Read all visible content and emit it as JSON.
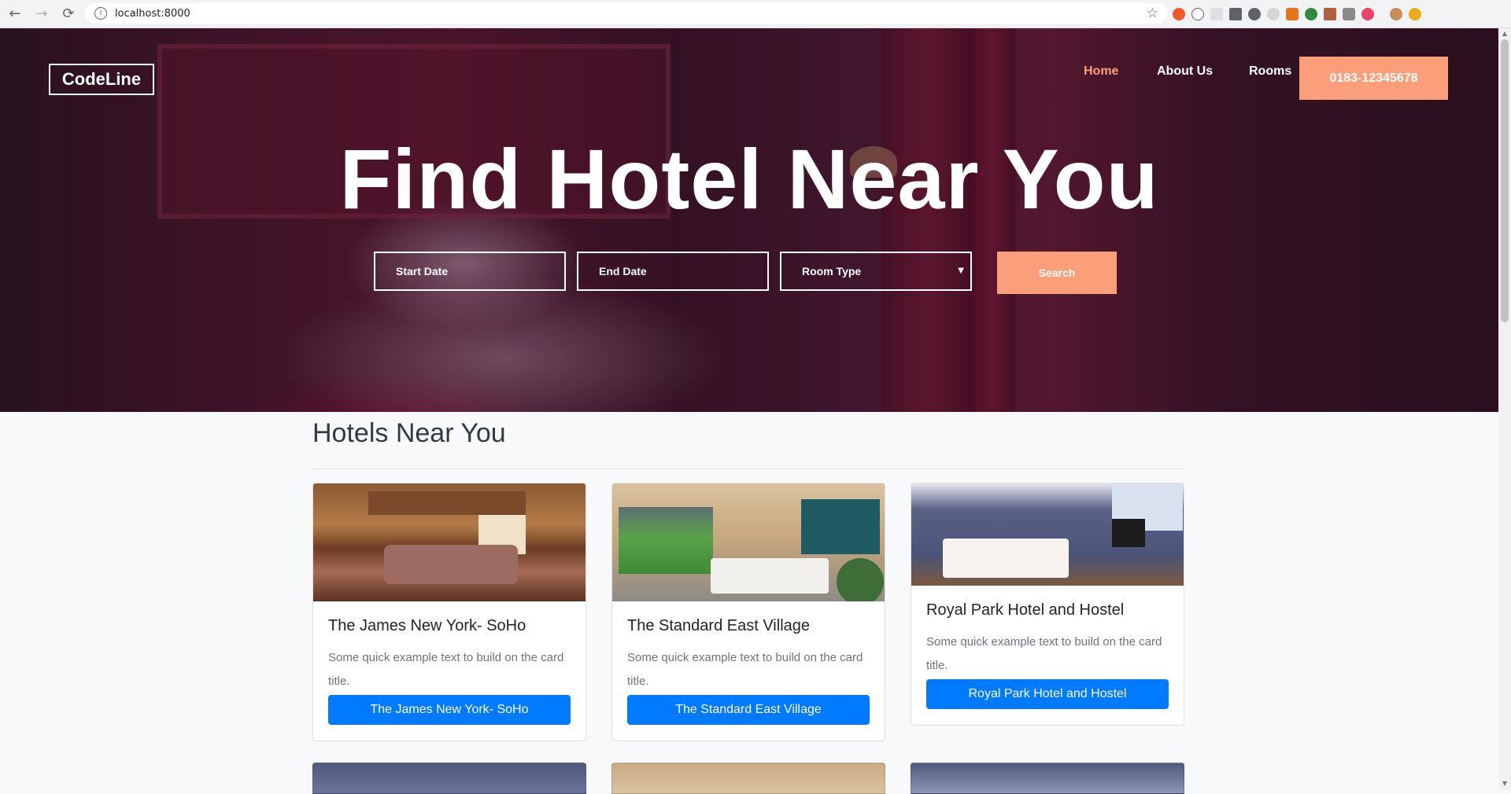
{
  "browser": {
    "url": "localhost:8000",
    "back_icon": "←",
    "forward_icon": "→",
    "reload_icon": "⟳",
    "info_icon": "i",
    "star_icon": "☆"
  },
  "header": {
    "logo": "CodeLine",
    "nav": [
      "Home",
      "About Us",
      "Rooms"
    ],
    "phone": "0183-12345678"
  },
  "hero": {
    "title": "Find Hotel Near You",
    "start_date": "Start Date",
    "end_date": "End Date",
    "room_type": "Room Type",
    "search_button": "Search"
  },
  "section": {
    "title": "Hotels Near You"
  },
  "cards": [
    {
      "title": "The James New York- SoHo",
      "text": "Some quick example text to build on the card title.",
      "button": "The James New York- SoHo"
    },
    {
      "title": "The Standard East Village",
      "text": "Some quick example text to build on the card title.",
      "button": "The Standard East Village"
    },
    {
      "title": "Royal Park Hotel and Hostel",
      "text": "Some quick example text to build on the card title.",
      "button": "Royal Park Hotel and Hostel"
    }
  ],
  "colors": {
    "accent": "#fa9f7a",
    "primary_button": "#007bff",
    "heading": "#343a40"
  }
}
